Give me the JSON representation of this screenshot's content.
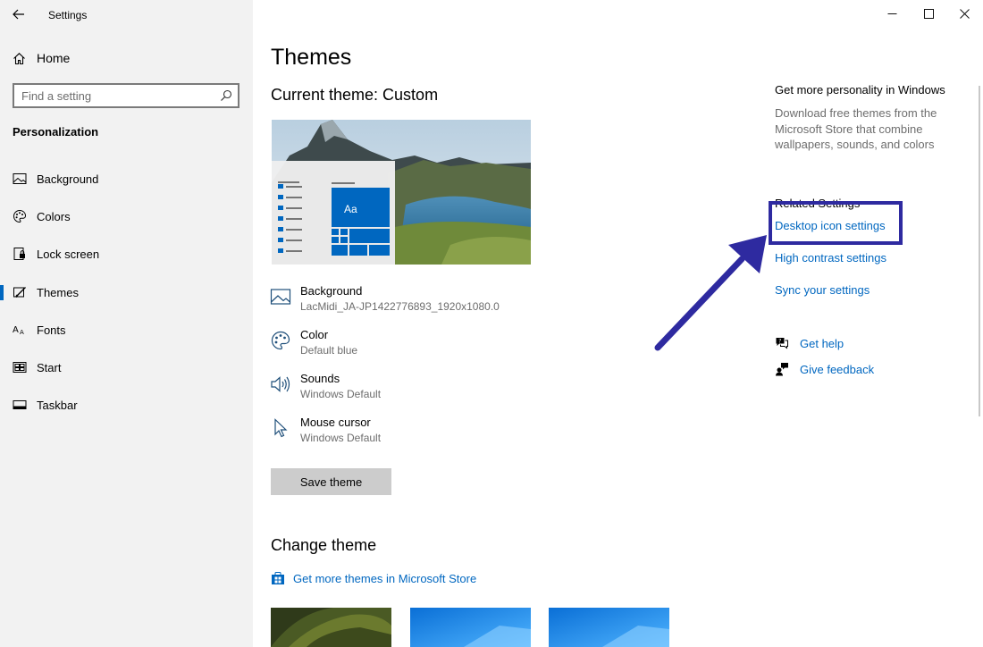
{
  "window": {
    "title": "Settings",
    "minimize": "–",
    "maximize": "☐",
    "close": "✕"
  },
  "sidebar": {
    "home_label": "Home",
    "search_placeholder": "Find a setting",
    "section": "Personalization",
    "items": [
      {
        "label": "Background",
        "icon": "image-icon"
      },
      {
        "label": "Colors",
        "icon": "palette-icon"
      },
      {
        "label": "Lock screen",
        "icon": "lock-screen-icon"
      },
      {
        "label": "Themes",
        "icon": "themes-icon",
        "active": true
      },
      {
        "label": "Fonts",
        "icon": "fonts-icon"
      },
      {
        "label": "Start",
        "icon": "start-icon"
      },
      {
        "label": "Taskbar",
        "icon": "taskbar-icon"
      }
    ]
  },
  "main": {
    "title": "Themes",
    "current_theme": "Current theme: Custom",
    "preview_tile_label": "Aa",
    "theme_items": [
      {
        "name": "Background",
        "value": "LacMidi_JA-JP1422776893_1920x1080.0",
        "icon": "image-icon"
      },
      {
        "name": "Color",
        "value": "Default blue",
        "icon": "palette-icon"
      },
      {
        "name": "Sounds",
        "value": "Windows Default",
        "icon": "speaker-icon"
      },
      {
        "name": "Mouse cursor",
        "value": "Windows Default",
        "icon": "cursor-icon"
      }
    ],
    "save_button": "Save theme",
    "change_theme": "Change theme",
    "store_link": "Get more themes in Microsoft Store"
  },
  "right": {
    "personality_title": "Get more personality in Windows",
    "personality_desc": "Download free themes from the Microsoft Store that combine wallpapers, sounds, and colors",
    "related_title": "Related Settings",
    "links": [
      "Desktop icon settings",
      "High contrast settings",
      "Sync your settings"
    ],
    "help": "Get help",
    "feedback": "Give feedback"
  },
  "colors": {
    "accent": "#0067c0",
    "annotation": "#2e2aa0",
    "sidebar_bg": "#f2f2f2"
  }
}
